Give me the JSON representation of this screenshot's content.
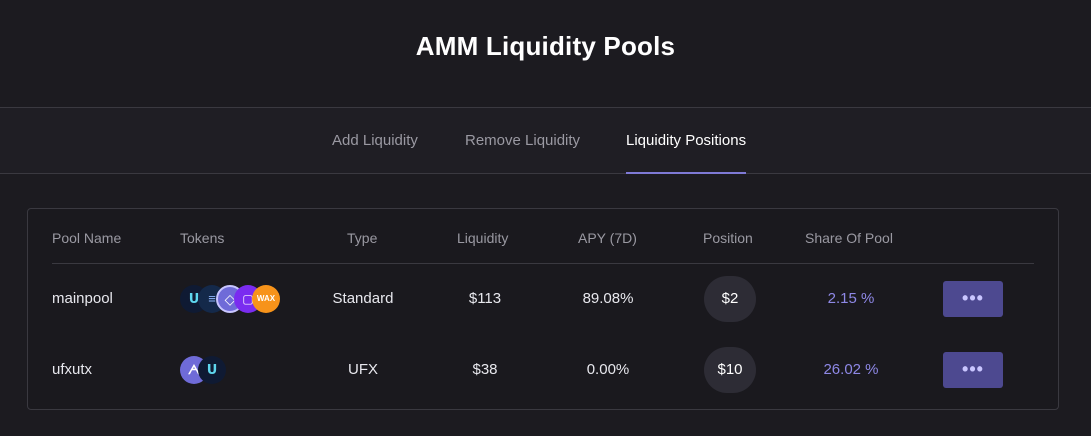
{
  "header": {
    "title": "AMM Liquidity Pools"
  },
  "tabs": [
    {
      "label": "Add Liquidity",
      "active": false
    },
    {
      "label": "Remove Liquidity",
      "active": false
    },
    {
      "label": "Liquidity Positions",
      "active": true
    }
  ],
  "table": {
    "columns": [
      "Pool Name",
      "Tokens",
      "Type",
      "Liquidity",
      "APY (7D)",
      "Position",
      "Share Of Pool"
    ],
    "rows": [
      {
        "pool_name": "mainpool",
        "tokens": [
          {
            "icon": "ufx-token-icon",
            "glyph": "ᑌ"
          },
          {
            "icon": "equal-token-icon",
            "glyph": "≡"
          },
          {
            "icon": "eos-token-icon",
            "glyph": "◇"
          },
          {
            "icon": "purple-square-token-icon",
            "glyph": "▢"
          },
          {
            "icon": "wax-token-icon",
            "glyph": "WAX"
          }
        ],
        "type": "Standard",
        "liquidity": "$113",
        "apy": "89.08%",
        "position": "$2",
        "share": "2.15 %",
        "more_label": "•••"
      },
      {
        "pool_name": "ufxutx",
        "tokens": [
          {
            "icon": "utx-token-icon",
            "glyph": "ᗅ"
          },
          {
            "icon": "ufx-token-icon",
            "glyph": "ᑌ"
          }
        ],
        "type": "UFX",
        "liquidity": "$38",
        "apy": "0.00%",
        "position": "$10",
        "share": "26.02 %",
        "more_label": "•••"
      }
    ]
  },
  "colors": {
    "background": "#1c1b20",
    "accent": "#7f7ad6",
    "share_text": "#8e88e6",
    "more_button": "#4d4990"
  }
}
